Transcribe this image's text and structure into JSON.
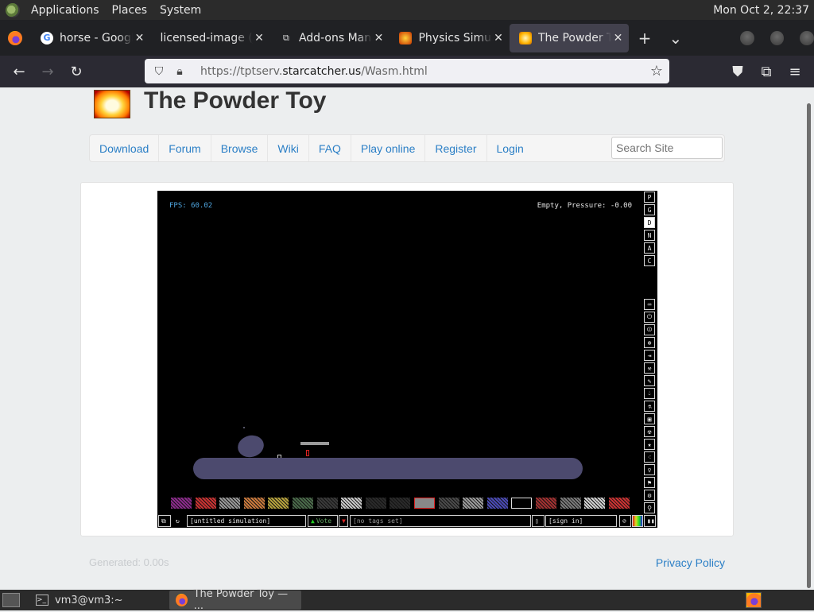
{
  "top_panel": {
    "menus": [
      "Applications",
      "Places",
      "System"
    ],
    "clock": "Mon Oct  2, 22:37"
  },
  "browser": {
    "tabs": [
      {
        "title": "horse - Google S",
        "icon": "google-icon"
      },
      {
        "title": "licensed-image (JPE",
        "icon": "none"
      },
      {
        "title": "Add-ons Manag",
        "icon": "puzzle-icon"
      },
      {
        "title": "Physics Simulat",
        "icon": "powder-toy-icon"
      },
      {
        "title": "The Powder Toy",
        "icon": "powder-toy-icon",
        "active": true
      }
    ],
    "url_prefix": "https://tptserv.",
    "url_domain": "starcatcher.us",
    "url_path": "/Wasm.html"
  },
  "site": {
    "title": "The Powder Toy",
    "nav": [
      "Download",
      "Forum",
      "Browse",
      "Wiki",
      "FAQ",
      "Play online",
      "Register",
      "Login"
    ],
    "search_placeholder": "Search Site",
    "footer_generated": "Generated: 0.00s",
    "footer_privacy": "Privacy Policy"
  },
  "sim": {
    "fps": "FPS: 60.02",
    "status": "Empty, Pressure: -0.00",
    "side_buttons_top": [
      "P",
      "G",
      "D",
      "N",
      "A",
      "C"
    ],
    "side_buttons_top_active": "D",
    "side_icons": [
      "keyboard-icon",
      "power-icon",
      "electronics-icon",
      "force-icon",
      "sensor-icon",
      "tools-icon",
      "pencil-icon",
      "liquid-icon",
      "gas-icon",
      "solid-icon",
      "radioactive-icon",
      "special-icon",
      "powders-icon",
      "life-icon",
      "favorites-icon",
      "decoration-icon",
      "search-icon"
    ],
    "sim_name": "[untitled simulation]",
    "vote": "Vote",
    "tags": "[no tags set]",
    "login": "[sign in]",
    "element_colors": [
      "#8a2a8a",
      "#c83232",
      "#9a9a9a",
      "#c8783c",
      "#b4a03c",
      "#4a6a4a",
      "#3a3a3a",
      "#c8c8c8",
      "#2a2a2a",
      "#2a2a2a",
      "#888888",
      "#4a4a4a",
      "#9a9a9a",
      "#4a4ab4",
      "#ffffff",
      "#a03030",
      "#7a7a7a",
      "#d0d0d0",
      "#c83232"
    ]
  },
  "taskbar": {
    "items": [
      {
        "label": "vm3@vm3:~",
        "icon": "terminal-icon"
      },
      {
        "label": "The Powder Toy — ...",
        "icon": "firefox-icon",
        "active": true
      }
    ]
  }
}
